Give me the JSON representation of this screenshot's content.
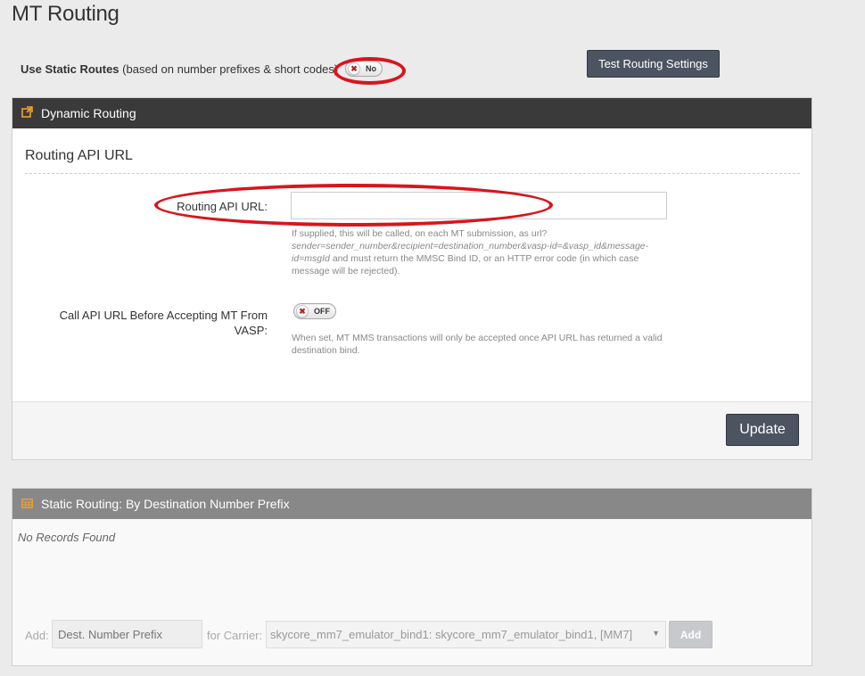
{
  "page": {
    "title": "MT Routing"
  },
  "static_routes": {
    "label_bold": "Use Static Routes",
    "label_rest": " (based on number prefixes & short codes)",
    "toggle_text": "No",
    "toggle_icon": "x-icon"
  },
  "test_button": {
    "label": "Test Routing Settings"
  },
  "dynamic_panel": {
    "header": "Dynamic Routing",
    "header_icon": "external-link-icon",
    "subtitle": "Routing API URL",
    "api_url": {
      "label": "Routing API URL:",
      "value": "",
      "help_prefix": "If supplied, this will be called, on each MT submission, as url?",
      "help_italic": "sender=sender_number&recipient=destination_number&vasp-id=&vasp_id&message-id=msgId",
      "help_suffix": " and must return the MMSC Bind ID, or an HTTP error code (in which case message will be rejected)."
    },
    "call_api": {
      "label": "Call API URL Before Accepting MT From VASP:",
      "toggle_text": "OFF",
      "help": "When set, MT MMS transactions will only be accepted once API URL has returned a valid destination bind."
    },
    "update_button": "Update"
  },
  "static_panel": {
    "header": "Static Routing: By Destination Number Prefix",
    "header_icon": "table-icon",
    "empty_text": "No Records Found",
    "add_label": "Add:",
    "prefix_placeholder": "Dest. Number Prefix",
    "for_carrier_label": "for Carrier:",
    "carrier_selected": "skycore_mm7_emulator_bind1: skycore_mm7_emulator_bind1, [MM7]",
    "add_button": "Add"
  },
  "colors": {
    "annotation_red": "#d8151c",
    "dark_header": "#3a3a3a",
    "gray_header": "#888888",
    "button": "#4d5461",
    "icon_orange": "#f0a22e"
  }
}
